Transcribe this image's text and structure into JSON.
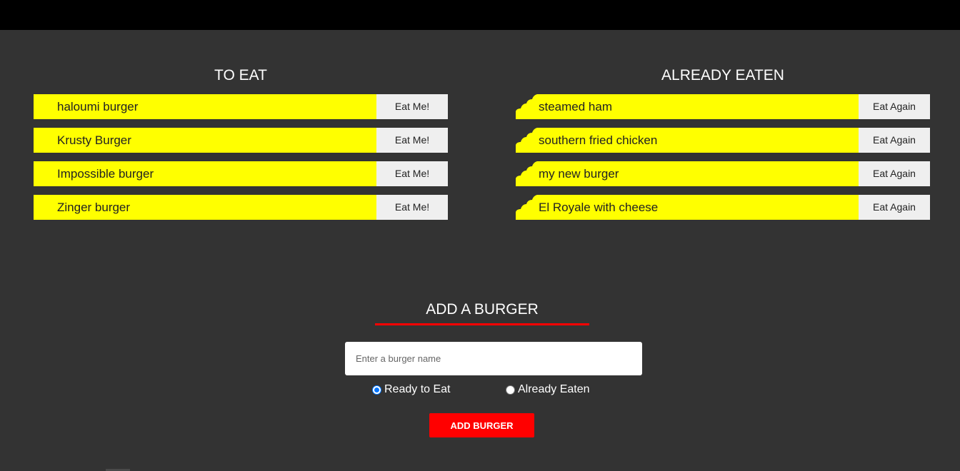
{
  "to_eat": {
    "title": "TO EAT",
    "button_label": "Eat Me!",
    "items": [
      {
        "name": "haloumi burger"
      },
      {
        "name": "Krusty Burger"
      },
      {
        "name": "Impossible burger"
      },
      {
        "name": "Zinger burger"
      }
    ]
  },
  "already_eaten": {
    "title": "ALREADY EATEN",
    "button_label": "Eat Again",
    "items": [
      {
        "name": "steamed ham"
      },
      {
        "name": "southern fried chicken"
      },
      {
        "name": "my new burger"
      },
      {
        "name": "El Royale with cheese"
      }
    ]
  },
  "add_form": {
    "title": "ADD A BURGER",
    "input_placeholder": "Enter a burger name",
    "input_value": "",
    "radio_ready_label": "Ready to Eat",
    "radio_eaten_label": "Already Eaten",
    "selected_radio": "Ready to Eat",
    "submit_label": "ADD BURGER"
  },
  "colors": {
    "background": "#333333",
    "topbar": "#000000",
    "item_bg": "#ffff00",
    "button_bg": "#efefef",
    "accent": "#ff0000"
  }
}
